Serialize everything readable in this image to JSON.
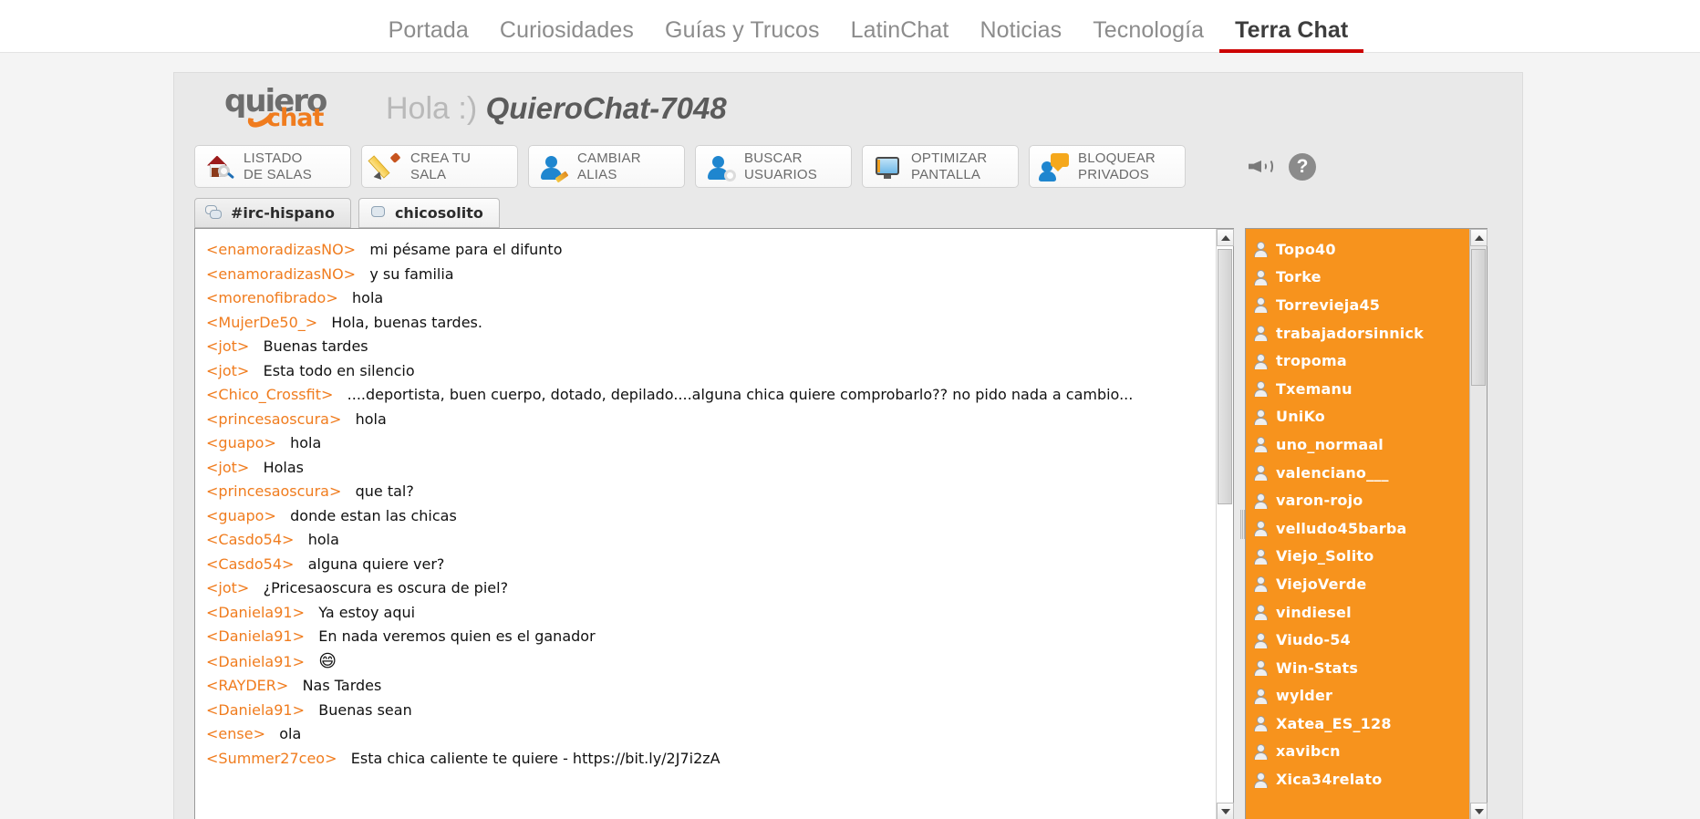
{
  "topnav": {
    "items": [
      {
        "label": "Portada",
        "active": false
      },
      {
        "label": "Curiosidades",
        "active": false
      },
      {
        "label": "Guías y Trucos",
        "active": false
      },
      {
        "label": "LatinChat",
        "active": false
      },
      {
        "label": "Noticias",
        "active": false
      },
      {
        "label": "Tecnología",
        "active": false
      },
      {
        "label": "Terra Chat",
        "active": true
      }
    ],
    "active_underline_color": "#cc0000"
  },
  "brand": {
    "logo_top": "quiero",
    "logo_bottom": "chat",
    "logo_color": "#f07c1e"
  },
  "header": {
    "greeting_prefix": "Hola  :)",
    "nickname": "QuieroChat-7048",
    "sound_icon": "speaker-icon",
    "help_icon": "help-icon",
    "help_label": "?"
  },
  "toolbar": {
    "buttons": [
      {
        "icon": "house-search-icon",
        "line1": "LISTADO",
        "line2": "DE SALAS"
      },
      {
        "icon": "pencil-icon",
        "line1": "CREA TU",
        "line2": "SALA"
      },
      {
        "icon": "person-edit-icon",
        "line1": "CAMBIAR",
        "line2": "ALIAS"
      },
      {
        "icon": "person-search-icon",
        "line1": "BUSCAR",
        "line2": "USUARIOS"
      },
      {
        "icon": "monitor-icon",
        "line1": "OPTIMIZAR",
        "line2": "PANTALLA"
      },
      {
        "icon": "block-private-icon",
        "line1": "BLOQUEAR",
        "line2": "PRIVADOS"
      }
    ]
  },
  "channel_tabs": [
    {
      "label": "#irc-hispano",
      "icon": "two-bubbles-icon",
      "active": true
    },
    {
      "label": "chicosolito",
      "icon": "single-bubble-icon",
      "active": false
    }
  ],
  "chat": {
    "nick_color": "#f07c1e",
    "messages": [
      {
        "nick": "<enamoradizasNO>",
        "text": "mi pésame para el difunto"
      },
      {
        "nick": "<enamoradizasNO>",
        "text": "y su familia"
      },
      {
        "nick": "<morenofibrado>",
        "text": "hola"
      },
      {
        "nick": "<MujerDe50_>",
        "text": "Hola, buenas tardes."
      },
      {
        "nick": "<jot>",
        "text": "Buenas tardes"
      },
      {
        "nick": "<jot>",
        "text": "Esta todo en silencio"
      },
      {
        "nick": "<Chico_Crossfit>",
        "text": "....deportista, buen cuerpo, dotado, depilado....alguna chica quiere comprobarlo?? no pido nada a cambio..."
      },
      {
        "nick": "<princesaoscura>",
        "text": "hola"
      },
      {
        "nick": "<guapo>",
        "text": "hola"
      },
      {
        "nick": "<jot>",
        "text": "Holas"
      },
      {
        "nick": "<princesaoscura>",
        "text": "que tal?"
      },
      {
        "nick": "<guapo>",
        "text": "donde estan las chicas"
      },
      {
        "nick": "<Casdo54>",
        "text": "hola"
      },
      {
        "nick": "<Casdo54>",
        "text": "alguna quiere ver?"
      },
      {
        "nick": "<jot>",
        "text": "¿Pricesaoscura es oscura de piel?"
      },
      {
        "nick": "<Daniela91>",
        "text": "Ya estoy aqui"
      },
      {
        "nick": "<Daniela91>",
        "text": "En nada veremos quien es el ganador"
      },
      {
        "nick": "<Daniela91>",
        "text": "😄"
      },
      {
        "nick": "<RAYDER>",
        "text": "Nas Tardes"
      },
      {
        "nick": "<Daniela91>",
        "text": "Buenas sean"
      },
      {
        "nick": "<ense>",
        "text": "ola"
      },
      {
        "nick": "<Summer27ceo>",
        "text": "Esta chica caliente te quiere -  https://bit.ly/2J7i2zA"
      }
    ]
  },
  "users": {
    "background_color": "#f7931d",
    "list": [
      "Topo40",
      "Torke",
      "Torrevieja45",
      "trabajadorsinnick",
      "tropoma",
      "Txemanu",
      "UniKo",
      "uno_normaal",
      "valenciano___",
      "varon-rojo",
      "velludo45barba",
      "Viejo_Solito",
      "ViejoVerde",
      "vindiesel",
      "Viudo-54",
      "Win-Stats",
      "wylder",
      "Xatea_ES_128",
      "xavibcn",
      "Xica34relato"
    ]
  }
}
